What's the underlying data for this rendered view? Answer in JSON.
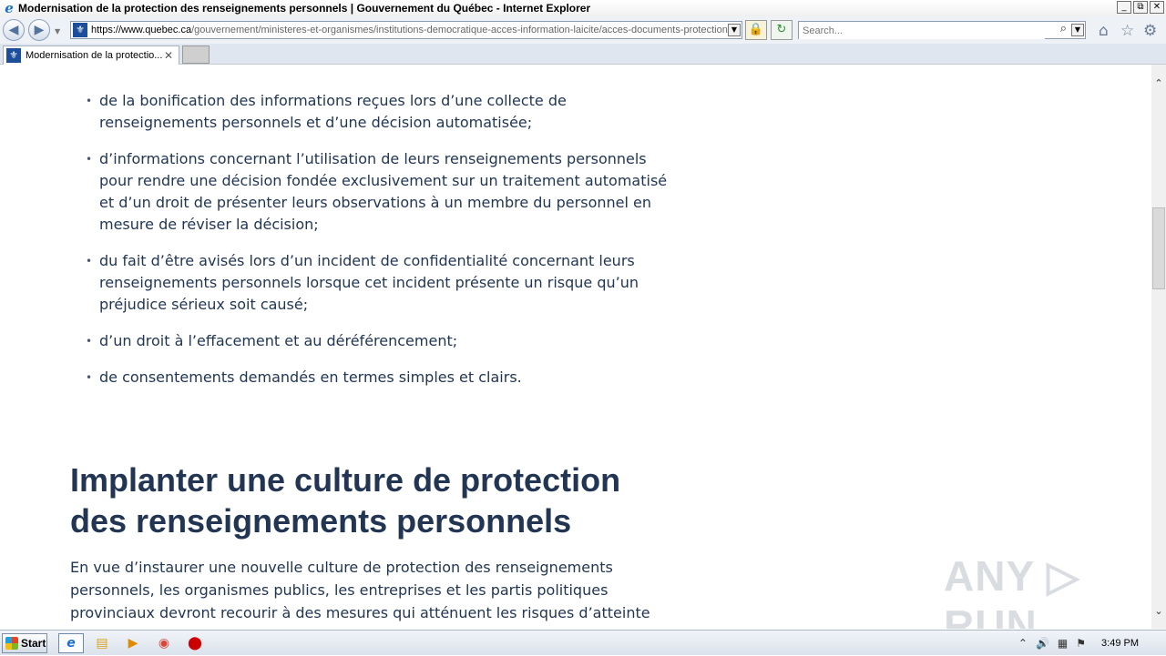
{
  "window": {
    "title": "Modernisation de la protection des renseignements personnels | Gouvernement du Québec - Internet Explorer",
    "app_icon": "ie-logo-icon",
    "controls": [
      "_",
      "⧉",
      "✕"
    ]
  },
  "navbar": {
    "back_glyph": "◀",
    "forward_glyph": "▶",
    "url_host": "https://www.quebec.ca",
    "url_path": "/gouvernement/ministeres-et-organismes/institutions-democratique-acces-information-laicite/acces-documents-protection",
    "site_favicon": "⚜",
    "search_placeholder": "Search...",
    "lock_glyph": "🔒",
    "refresh_glyph": "↻",
    "home_glyph": "⌂",
    "favorites_glyph": "☆",
    "tools_glyph": "⚙"
  },
  "tabs": [
    {
      "label": "Modernisation de la protectio...",
      "close": "✕"
    }
  ],
  "content": {
    "bullets": [
      "de la bonification des informations reçues lors d’une collecte de renseignements personnels et d’une décision automatisée;",
      "d’informations concernant l’utilisation de leurs renseignements personnels pour rendre une décision fondée exclusivement sur un traitement automatisé et d’un droit de présenter leurs observations à un membre du personnel en mesure de réviser la décision;",
      "du fait d’être avisés lors d’un incident de confidentialité concernant leurs renseignements personnels lorsque cet incident présente un risque qu’un préjudice sérieux soit causé;",
      "d’un droit à l’effacement et au déréférencement;",
      "de consentements demandés en termes simples et clairs."
    ],
    "section_title": "Implanter une culture de protection des renseignements personnels",
    "section_text": "En vue d’instaurer une nouvelle culture de protection des renseignements personnels, les organismes publics, les entreprises et les partis politiques provinciaux devront recourir à des mesures qui atténuent les risques d’atteinte au droit à la vie privée des",
    "watermark": "ANY ▷ RUN"
  },
  "taskbar": {
    "start_label": "Start",
    "clock": "3:49 PM"
  }
}
